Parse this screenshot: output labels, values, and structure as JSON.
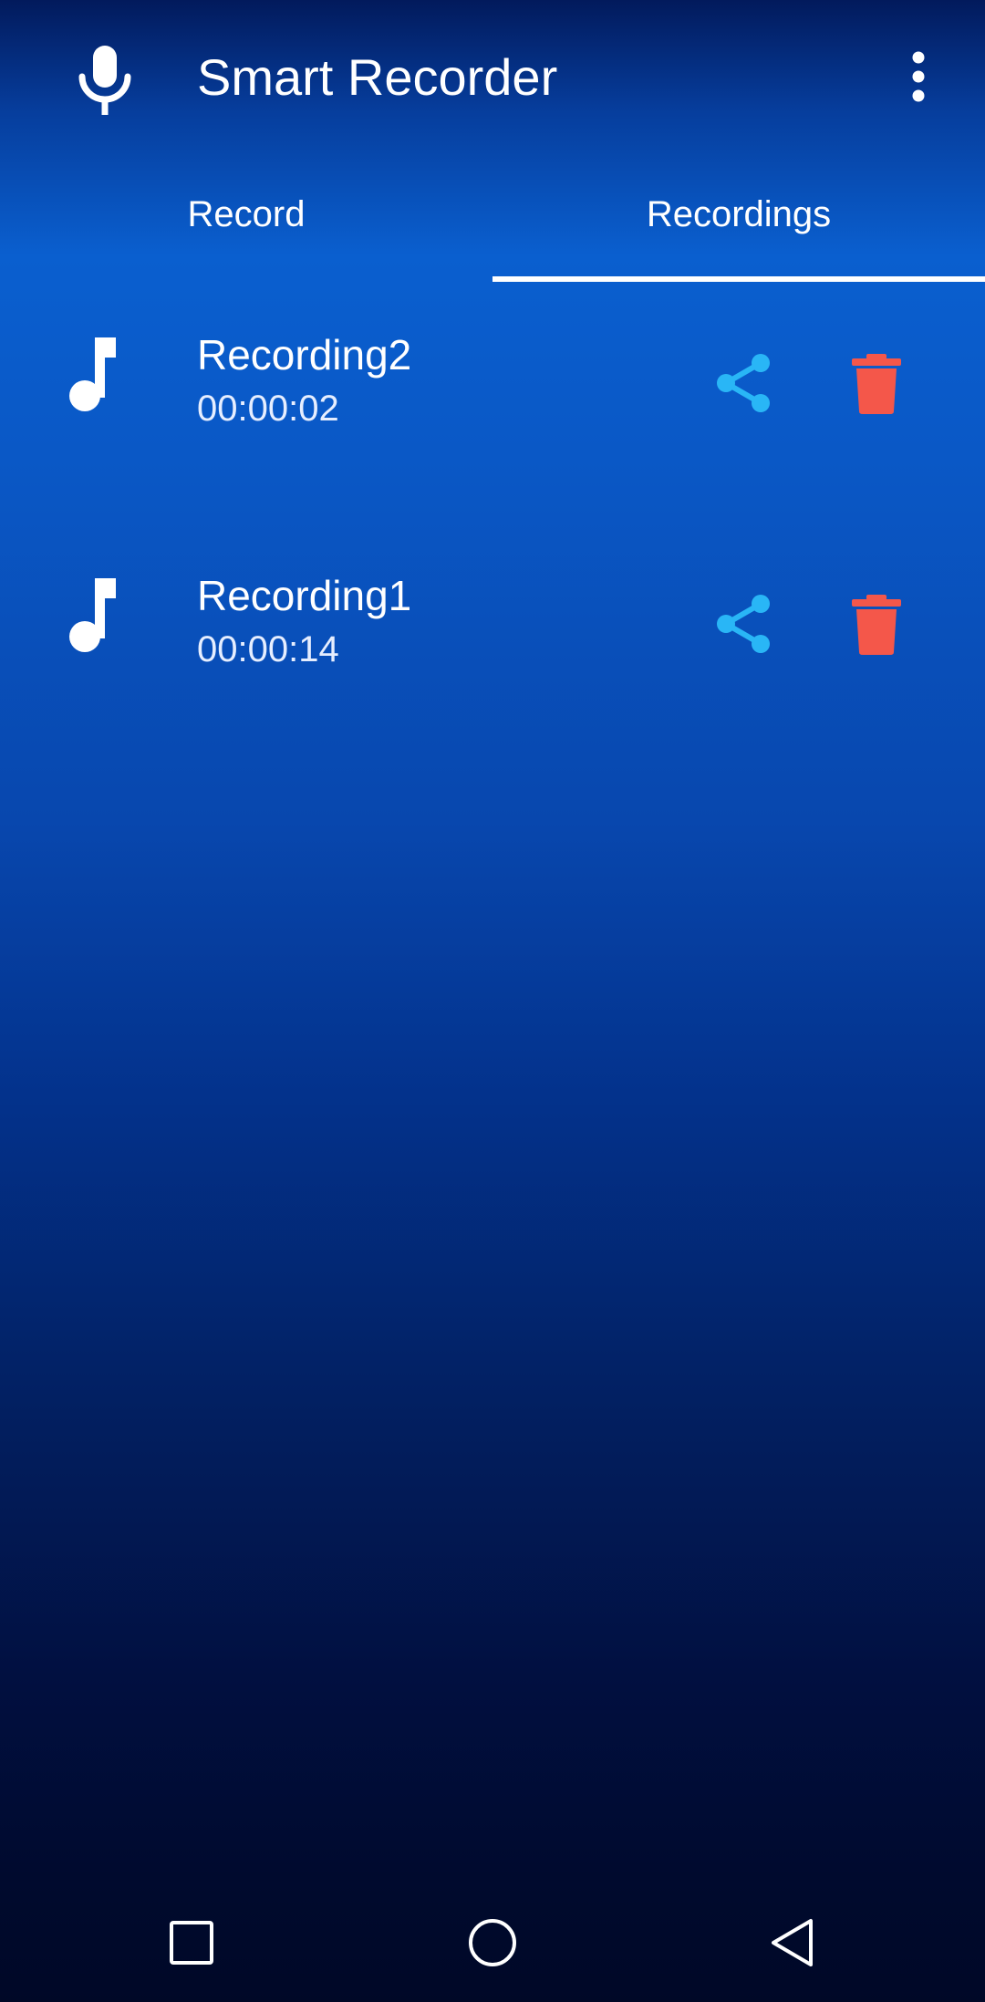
{
  "appbar": {
    "title": "Smart Recorder",
    "leading_icon": "microphone-icon",
    "menu_icon": "more-vert-icon"
  },
  "tabs": [
    {
      "label": "Record",
      "selected": false
    },
    {
      "label": "Recordings",
      "selected": true
    }
  ],
  "recordings": [
    {
      "name": "Recording2",
      "duration": "00:00:02",
      "icon": "music-note-icon"
    },
    {
      "name": "Recording1",
      "duration": "00:00:14",
      "icon": "music-note-icon"
    }
  ],
  "navbar": {
    "buttons": [
      "recents-square-icon",
      "home-circle-icon",
      "back-triangle-icon"
    ]
  },
  "colors": {
    "share": "#29b6f6",
    "delete": "#f4574a",
    "text": "#ffffff"
  }
}
